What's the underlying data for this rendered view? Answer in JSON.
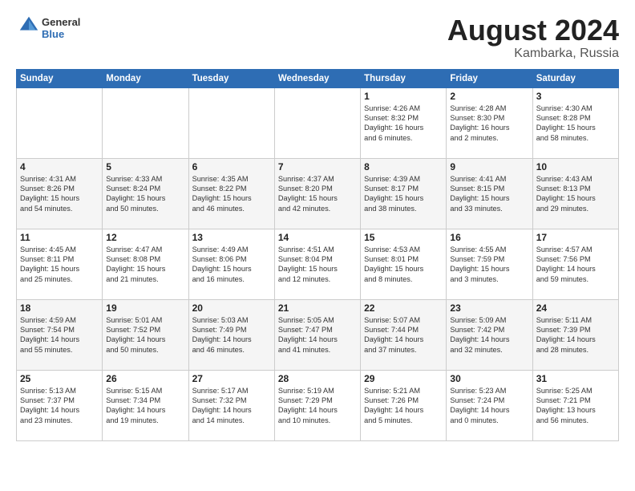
{
  "header": {
    "logo_general": "General",
    "logo_blue": "Blue",
    "title": "August 2024",
    "location": "Kambarka, Russia"
  },
  "days_of_week": [
    "Sunday",
    "Monday",
    "Tuesday",
    "Wednesday",
    "Thursday",
    "Friday",
    "Saturday"
  ],
  "weeks": [
    [
      {
        "day": "",
        "text": ""
      },
      {
        "day": "",
        "text": ""
      },
      {
        "day": "",
        "text": ""
      },
      {
        "day": "",
        "text": ""
      },
      {
        "day": "1",
        "text": "Sunrise: 4:26 AM\nSunset: 8:32 PM\nDaylight: 16 hours\nand 6 minutes."
      },
      {
        "day": "2",
        "text": "Sunrise: 4:28 AM\nSunset: 8:30 PM\nDaylight: 16 hours\nand 2 minutes."
      },
      {
        "day": "3",
        "text": "Sunrise: 4:30 AM\nSunset: 8:28 PM\nDaylight: 15 hours\nand 58 minutes."
      }
    ],
    [
      {
        "day": "4",
        "text": "Sunrise: 4:31 AM\nSunset: 8:26 PM\nDaylight: 15 hours\nand 54 minutes."
      },
      {
        "day": "5",
        "text": "Sunrise: 4:33 AM\nSunset: 8:24 PM\nDaylight: 15 hours\nand 50 minutes."
      },
      {
        "day": "6",
        "text": "Sunrise: 4:35 AM\nSunset: 8:22 PM\nDaylight: 15 hours\nand 46 minutes."
      },
      {
        "day": "7",
        "text": "Sunrise: 4:37 AM\nSunset: 8:20 PM\nDaylight: 15 hours\nand 42 minutes."
      },
      {
        "day": "8",
        "text": "Sunrise: 4:39 AM\nSunset: 8:17 PM\nDaylight: 15 hours\nand 38 minutes."
      },
      {
        "day": "9",
        "text": "Sunrise: 4:41 AM\nSunset: 8:15 PM\nDaylight: 15 hours\nand 33 minutes."
      },
      {
        "day": "10",
        "text": "Sunrise: 4:43 AM\nSunset: 8:13 PM\nDaylight: 15 hours\nand 29 minutes."
      }
    ],
    [
      {
        "day": "11",
        "text": "Sunrise: 4:45 AM\nSunset: 8:11 PM\nDaylight: 15 hours\nand 25 minutes."
      },
      {
        "day": "12",
        "text": "Sunrise: 4:47 AM\nSunset: 8:08 PM\nDaylight: 15 hours\nand 21 minutes."
      },
      {
        "day": "13",
        "text": "Sunrise: 4:49 AM\nSunset: 8:06 PM\nDaylight: 15 hours\nand 16 minutes."
      },
      {
        "day": "14",
        "text": "Sunrise: 4:51 AM\nSunset: 8:04 PM\nDaylight: 15 hours\nand 12 minutes."
      },
      {
        "day": "15",
        "text": "Sunrise: 4:53 AM\nSunset: 8:01 PM\nDaylight: 15 hours\nand 8 minutes."
      },
      {
        "day": "16",
        "text": "Sunrise: 4:55 AM\nSunset: 7:59 PM\nDaylight: 15 hours\nand 3 minutes."
      },
      {
        "day": "17",
        "text": "Sunrise: 4:57 AM\nSunset: 7:56 PM\nDaylight: 14 hours\nand 59 minutes."
      }
    ],
    [
      {
        "day": "18",
        "text": "Sunrise: 4:59 AM\nSunset: 7:54 PM\nDaylight: 14 hours\nand 55 minutes."
      },
      {
        "day": "19",
        "text": "Sunrise: 5:01 AM\nSunset: 7:52 PM\nDaylight: 14 hours\nand 50 minutes."
      },
      {
        "day": "20",
        "text": "Sunrise: 5:03 AM\nSunset: 7:49 PM\nDaylight: 14 hours\nand 46 minutes."
      },
      {
        "day": "21",
        "text": "Sunrise: 5:05 AM\nSunset: 7:47 PM\nDaylight: 14 hours\nand 41 minutes."
      },
      {
        "day": "22",
        "text": "Sunrise: 5:07 AM\nSunset: 7:44 PM\nDaylight: 14 hours\nand 37 minutes."
      },
      {
        "day": "23",
        "text": "Sunrise: 5:09 AM\nSunset: 7:42 PM\nDaylight: 14 hours\nand 32 minutes."
      },
      {
        "day": "24",
        "text": "Sunrise: 5:11 AM\nSunset: 7:39 PM\nDaylight: 14 hours\nand 28 minutes."
      }
    ],
    [
      {
        "day": "25",
        "text": "Sunrise: 5:13 AM\nSunset: 7:37 PM\nDaylight: 14 hours\nand 23 minutes."
      },
      {
        "day": "26",
        "text": "Sunrise: 5:15 AM\nSunset: 7:34 PM\nDaylight: 14 hours\nand 19 minutes."
      },
      {
        "day": "27",
        "text": "Sunrise: 5:17 AM\nSunset: 7:32 PM\nDaylight: 14 hours\nand 14 minutes."
      },
      {
        "day": "28",
        "text": "Sunrise: 5:19 AM\nSunset: 7:29 PM\nDaylight: 14 hours\nand 10 minutes."
      },
      {
        "day": "29",
        "text": "Sunrise: 5:21 AM\nSunset: 7:26 PM\nDaylight: 14 hours\nand 5 minutes."
      },
      {
        "day": "30",
        "text": "Sunrise: 5:23 AM\nSunset: 7:24 PM\nDaylight: 14 hours\nand 0 minutes."
      },
      {
        "day": "31",
        "text": "Sunrise: 5:25 AM\nSunset: 7:21 PM\nDaylight: 13 hours\nand 56 minutes."
      }
    ]
  ]
}
